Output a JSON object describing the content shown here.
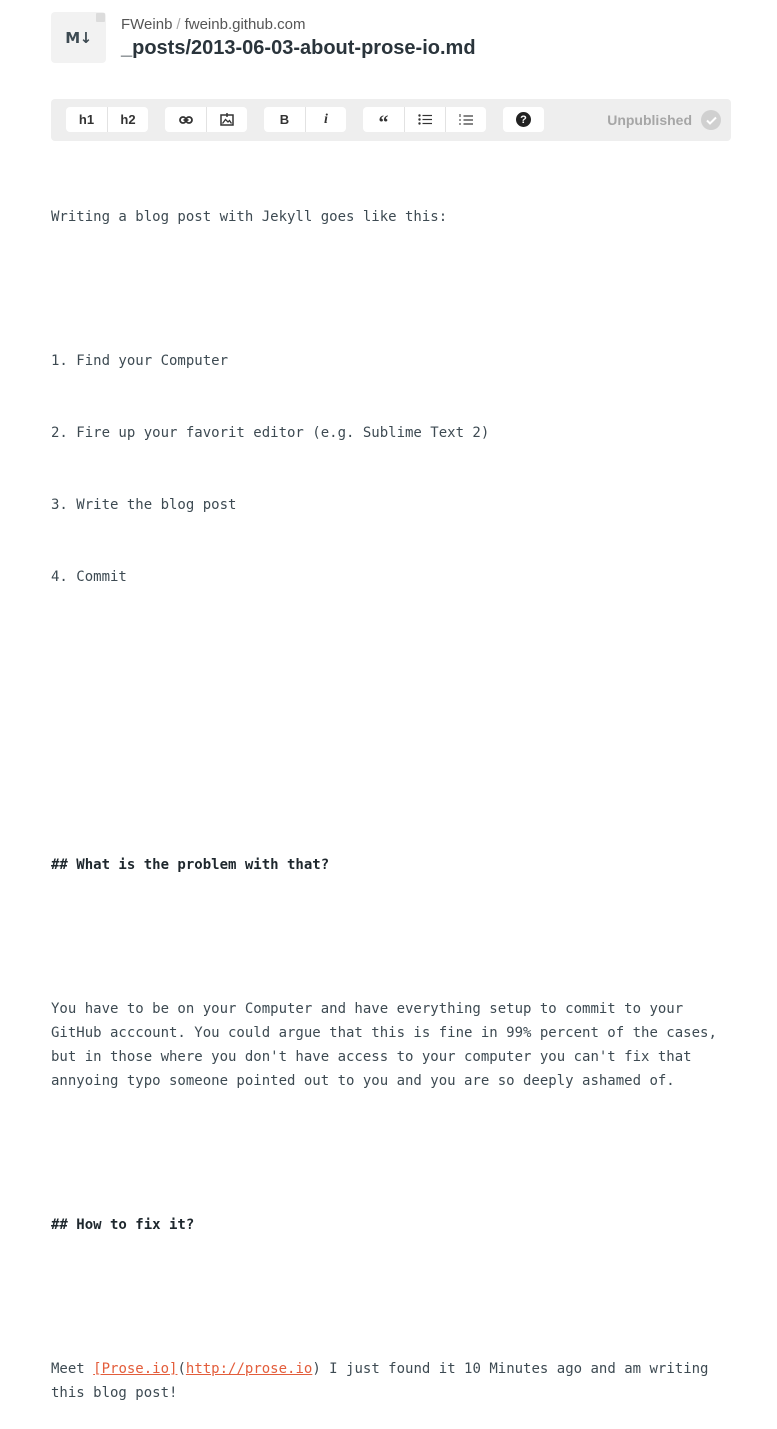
{
  "header": {
    "file_icon_label": "M↓",
    "owner": "FWeinb",
    "separator": "/",
    "repo": "fweinb.github.com",
    "file_path": "_posts/2013-06-03-about-prose-io.md"
  },
  "toolbar": {
    "h1_label": "h1",
    "h2_label": "h2",
    "link_icon": "link-icon",
    "image_icon": "image-icon",
    "bold_label": "B",
    "italic_label": "i",
    "quote_label": "“",
    "bullet_list_icon": "bullet-list-icon",
    "numbered_list_icon": "numbered-list-icon",
    "help_label": "?",
    "status_label": "Unpublished",
    "status_icon": "check-circle-icon"
  },
  "editor": {
    "intro": "Writing a blog post with Jekyll goes like this:",
    "steps": [
      "1. Find your Computer",
      "2. Fire up your favorit editor (e.g. Sublime Text 2)",
      "3. Write the blog post",
      "4. Commit"
    ],
    "heading1": "## What is the problem with that?",
    "paragraph1": "You have to be on your Computer and have everything setup to commit to your GitHub acccount. You could argue that this is fine in 99% percent of the cases, but in those where you don't have access to your computer you can't fix that annyoing typo someone pointed out to you and you are so deeply ashamed of.",
    "heading2": "## How to fix it?",
    "closing": {
      "prefix": "Meet ",
      "link_text": "[Prose.io]",
      "paren_open": "(",
      "link_url": "http://prose.io",
      "suffix": ") I just found it 10 Minutes ago and am writing this blog post!"
    }
  },
  "colors": {
    "link": "#e35d3b",
    "text": "#3d4a52",
    "toolbar_bg": "#eeeeee",
    "status": "#a6a6a6"
  }
}
